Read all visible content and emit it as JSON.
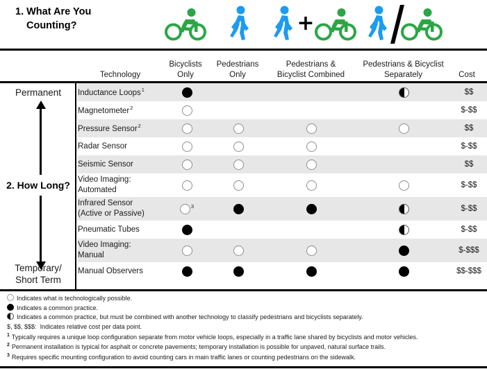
{
  "header": {
    "question1_line1": "1. What Are You",
    "question1_line2": "Counting?",
    "icon_groups": [
      {
        "name": "bicyclist-only-icon-group",
        "icons": [
          "bicyclist-green"
        ]
      },
      {
        "name": "pedestrian-only-icon-group",
        "icons": [
          "pedestrian-blue"
        ]
      },
      {
        "name": "pedestrian-and-bicyclist-combined-icon-group",
        "icons": [
          "pedestrian-blue",
          "plus",
          "bicyclist-green"
        ],
        "operator": "+"
      },
      {
        "name": "pedestrian-and-bicyclist-separately-icon-group",
        "icons": [
          "pedestrian-blue",
          "slash",
          "bicyclist-green"
        ],
        "operator": "/"
      }
    ]
  },
  "columns": {
    "technology": "Technology",
    "bicyclists_only_l1": "Bicyclists",
    "bicyclists_only_l2": "Only",
    "pedestrians_only_l1": "Pedestrians",
    "pedestrians_only_l2": "Only",
    "combined_l1": "Pedestrians &",
    "combined_l2": "Bicyclist Combined",
    "separately_l1": "Pedestrians & Bicyclist",
    "separately_l2": "Separately",
    "cost": "Cost"
  },
  "sidebar": {
    "top_label": "Permanent",
    "mid_label": "2. How Long?",
    "bottom_label_l1": "Temporary/",
    "bottom_label_l2": "Short Term"
  },
  "rows": [
    {
      "technology_l1": "Inductance Loops",
      "technology_l2": "",
      "footnote": "1",
      "bicyclists_only": "filled",
      "pedestrians_only": "none",
      "combined": "none",
      "separately": "half",
      "bo_footnote": "",
      "cost": "$$",
      "shaded": true
    },
    {
      "technology_l1": "Magnetometer",
      "technology_l2": "",
      "footnote": "2",
      "bicyclists_only": "open",
      "pedestrians_only": "none",
      "combined": "none",
      "separately": "none",
      "bo_footnote": "",
      "cost": "$-$$",
      "shaded": false
    },
    {
      "technology_l1": "Pressure Sensor",
      "technology_l2": "",
      "footnote": "2",
      "bicyclists_only": "open",
      "pedestrians_only": "open",
      "combined": "open",
      "separately": "open",
      "bo_footnote": "",
      "cost": "$$",
      "shaded": true
    },
    {
      "technology_l1": "Radar Sensor",
      "technology_l2": "",
      "footnote": "",
      "bicyclists_only": "open",
      "pedestrians_only": "open",
      "combined": "open",
      "separately": "none",
      "bo_footnote": "",
      "cost": "$-$$",
      "shaded": false
    },
    {
      "technology_l1": "Seismic Sensor",
      "technology_l2": "",
      "footnote": "",
      "bicyclists_only": "open",
      "pedestrians_only": "open",
      "combined": "open",
      "separately": "none",
      "bo_footnote": "",
      "cost": "$$",
      "shaded": true
    },
    {
      "technology_l1": "Video Imaging:",
      "technology_l2": "Automated",
      "footnote": "",
      "bicyclists_only": "open",
      "pedestrians_only": "open",
      "combined": "open",
      "separately": "open",
      "bo_footnote": "",
      "cost": "$-$$",
      "shaded": false
    },
    {
      "technology_l1": "Infrared Sensor",
      "technology_l2": "(Active or Passive)",
      "footnote": "",
      "bicyclists_only": "open",
      "pedestrians_only": "filled",
      "combined": "filled",
      "separately": "half",
      "bo_footnote": "3",
      "cost": "$-$$",
      "shaded": true
    },
    {
      "technology_l1": "Pneumatic Tubes",
      "technology_l2": "",
      "footnote": "",
      "bicyclists_only": "filled",
      "pedestrians_only": "none",
      "combined": "none",
      "separately": "half",
      "bo_footnote": "",
      "cost": "$-$$",
      "shaded": false
    },
    {
      "technology_l1": "Video Imaging:",
      "technology_l2": "Manual",
      "footnote": "",
      "bicyclists_only": "open",
      "pedestrians_only": "open",
      "combined": "open",
      "separately": "filled",
      "bo_footnote": "",
      "cost": "$-$$$",
      "shaded": true
    },
    {
      "technology_l1": "Manual Observers",
      "technology_l2": "",
      "footnote": "",
      "bicyclists_only": "filled",
      "pedestrians_only": "filled",
      "combined": "filled",
      "separately": "filled",
      "bo_footnote": "",
      "cost": "$$-$$$",
      "shaded": false
    }
  ],
  "legend": {
    "open_text": "Indicates what is technologically possible.",
    "filled_text": "Indicates a common practice.",
    "half_text": "Indicates a common practice, but must be combined with another technology to classify pedestrians and bicyclists separately.",
    "cost_key_label": "$, $$, $$$:",
    "cost_key_text": "Indicates relative cost per data point.",
    "footnotes": [
      {
        "num": "1",
        "text": "Typically requires a unique loop configuration separate from motor vehicle loops, especially in a traffic lane shared by bicyclists and motor vehicles."
      },
      {
        "num": "2",
        "text": "Permanent installation is typical for asphalt or concrete pavements; temporary installation is possible for unpaved, natural surface trails."
      },
      {
        "num": "3",
        "text": "Requires specific mounting configuration to avoid counting cars in main traffic lanes or counting pedestrians on the sidewalk."
      }
    ]
  },
  "colors": {
    "bicyclist_green": "#2BA646",
    "pedestrian_blue": "#1C9BEF",
    "shade_row": "#E7E7E7",
    "rule": "#000000"
  }
}
